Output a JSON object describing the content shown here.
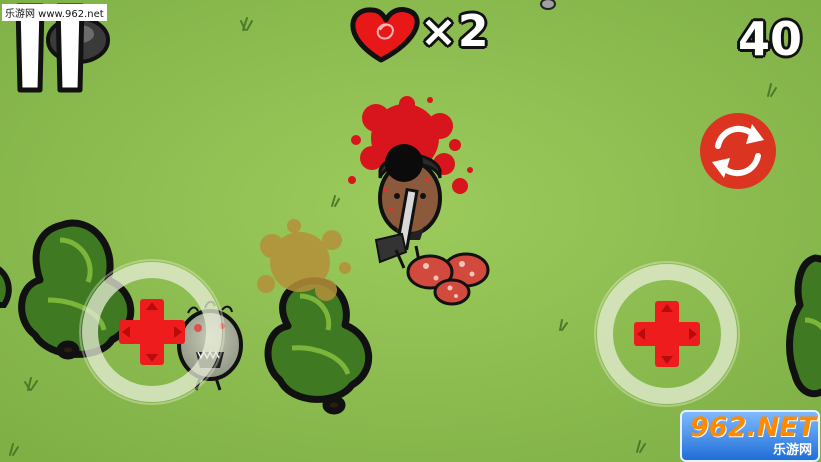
{
  "hud": {
    "site_tag": "乐游网 www.962.net",
    "lives_count": "×2",
    "score": "40"
  },
  "watermark": {
    "top": "962.NET",
    "bottom": "乐游网"
  },
  "icons": {
    "pause": "pause-icon",
    "heart": "heart-icon",
    "reload": "reload-icon",
    "dpad": "dpad-icon"
  },
  "colors": {
    "grass": "#8dbd4f",
    "dpad_red": "#ee1c1c",
    "reload_red": "#e3261c",
    "blood": "#d8141c"
  }
}
